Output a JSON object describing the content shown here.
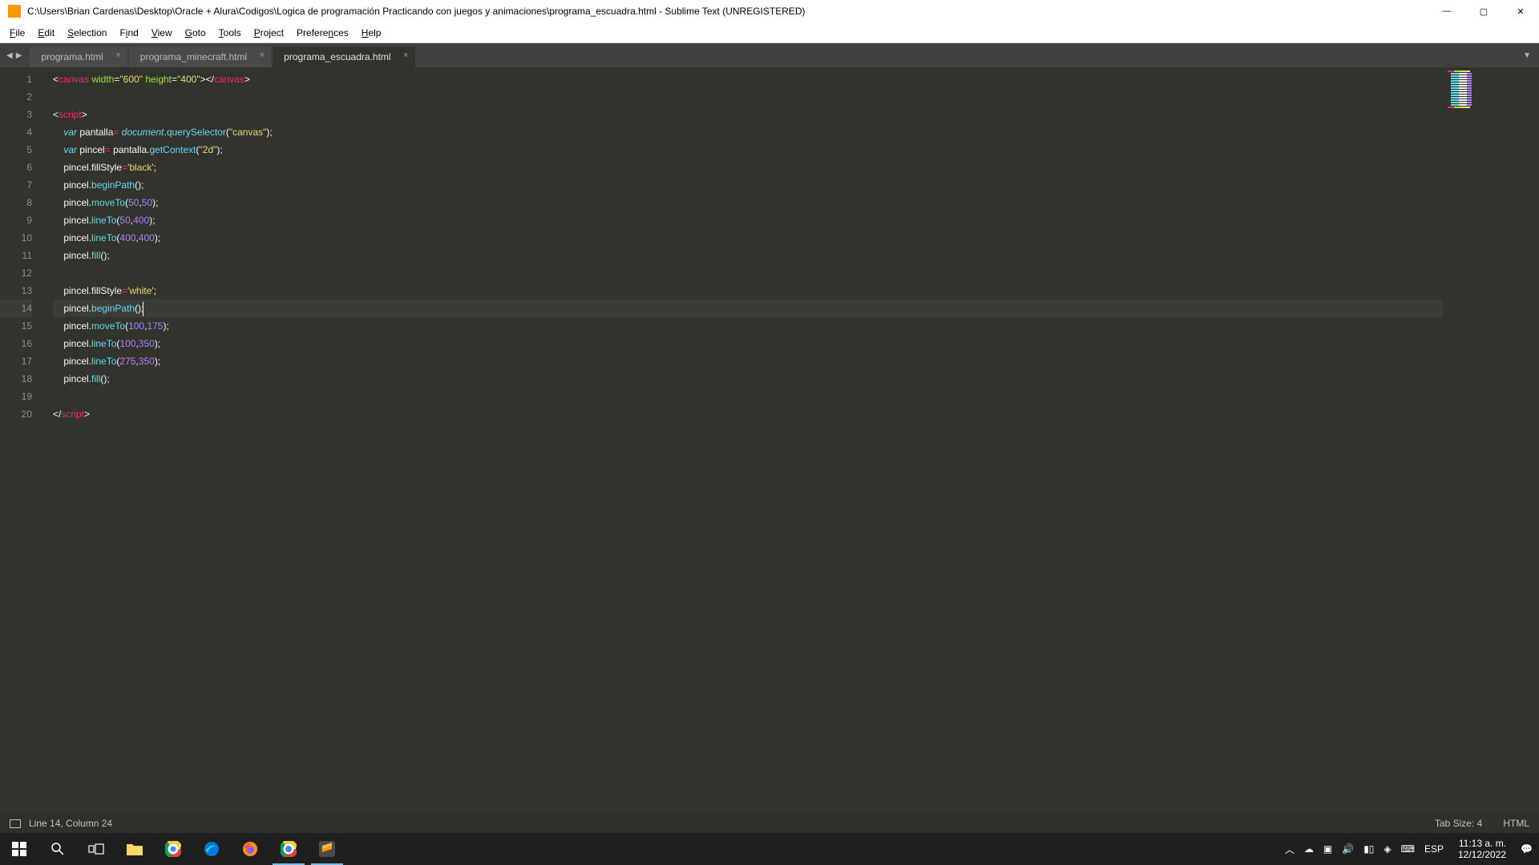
{
  "title": "C:\\Users\\Brian Cardenas\\Desktop\\Oracle + Alura\\Codigos\\Logica de programación Practicando con juegos y animaciones\\programa_escuadra.html - Sublime Text (UNREGISTERED)",
  "menu": {
    "file": "File",
    "edit": "Edit",
    "selection": "Selection",
    "find": "Find",
    "view": "View",
    "goto": "Goto",
    "tools": "Tools",
    "project": "Project",
    "preferences": "Preferences",
    "help": "Help"
  },
  "tabs": [
    {
      "label": "programa.html",
      "active": false
    },
    {
      "label": "programa_minecraft.html",
      "active": false
    },
    {
      "label": "programa_escuadra.html",
      "active": true
    }
  ],
  "code": {
    "lines": [
      {
        "n": 1,
        "html": "<span class='tok-punc'>&lt;</span><span class='tok-tag'>canvas</span> <span class='tok-attr'>width</span><span class='tok-punc'>=</span><span class='tok-str'>\"600\"</span> <span class='tok-attr'>height</span><span class='tok-punc'>=</span><span class='tok-str'>\"400\"</span><span class='tok-punc'>&gt;&lt;/</span><span class='tok-tag'>canvas</span><span class='tok-punc'>&gt;</span>"
      },
      {
        "n": 2,
        "html": ""
      },
      {
        "n": 3,
        "html": "<span class='tok-punc'>&lt;</span><span class='tok-tag'>script</span><span class='tok-punc'>&gt;</span>"
      },
      {
        "n": 4,
        "html": "    <span class='tok-kw'>var</span> <span class='tok-var'>pantalla</span><span class='tok-kw2'>=</span> <span class='tok-obj'>document</span><span class='tok-punc'>.</span><span class='tok-func'>querySelector</span><span class='tok-punc'>(</span><span class='tok-str'>\"canvas\"</span><span class='tok-punc'>);</span>"
      },
      {
        "n": 5,
        "html": "    <span class='tok-kw'>var</span> <span class='tok-var'>pincel</span><span class='tok-kw2'>=</span> <span class='tok-var'>pantalla</span><span class='tok-punc'>.</span><span class='tok-func'>getContext</span><span class='tok-punc'>(</span><span class='tok-str'>\"2d\"</span><span class='tok-punc'>);</span>"
      },
      {
        "n": 6,
        "html": "    <span class='tok-var'>pincel</span><span class='tok-punc'>.</span><span class='tok-var'>fillStyle</span><span class='tok-kw2'>=</span><span class='tok-str'>'black'</span><span class='tok-punc'>;</span>"
      },
      {
        "n": 7,
        "html": "    <span class='tok-var'>pincel</span><span class='tok-punc'>.</span><span class='tok-func'>beginPath</span><span class='tok-punc'>();</span>"
      },
      {
        "n": 8,
        "html": "    <span class='tok-var'>pincel</span><span class='tok-punc'>.</span><span class='tok-func'>moveTo</span><span class='tok-punc'>(</span><span class='tok-num'>50</span><span class='tok-punc'>,</span><span class='tok-num'>50</span><span class='tok-punc'>);</span>"
      },
      {
        "n": 9,
        "html": "    <span class='tok-var'>pincel</span><span class='tok-punc'>.</span><span class='tok-func'>lineTo</span><span class='tok-punc'>(</span><span class='tok-num'>50</span><span class='tok-punc'>,</span><span class='tok-num'>400</span><span class='tok-punc'>);</span>"
      },
      {
        "n": 10,
        "html": "    <span class='tok-var'>pincel</span><span class='tok-punc'>.</span><span class='tok-func'>lineTo</span><span class='tok-punc'>(</span><span class='tok-num'>400</span><span class='tok-punc'>,</span><span class='tok-num'>400</span><span class='tok-punc'>);</span>"
      },
      {
        "n": 11,
        "html": "    <span class='tok-var'>pincel</span><span class='tok-punc'>.</span><span class='tok-func'>fill</span><span class='tok-punc'>();</span>"
      },
      {
        "n": 12,
        "html": ""
      },
      {
        "n": 13,
        "html": "    <span class='tok-var'>pincel</span><span class='tok-punc'>.</span><span class='tok-var'>fillStyle</span><span class='tok-kw2'>=</span><span class='tok-str'>'white'</span><span class='tok-punc'>;</span>"
      },
      {
        "n": 14,
        "html": "    <span class='tok-var'>pincel</span><span class='tok-punc'>.</span><span class='tok-func'>beginPath</span><span class='tok-punc'>();</span><span class='cursor'></span>",
        "hl": true
      },
      {
        "n": 15,
        "html": "    <span class='tok-var'>pincel</span><span class='tok-punc'>.</span><span class='tok-func'>moveTo</span><span class='tok-punc'>(</span><span class='tok-num'>100</span><span class='tok-punc'>,</span><span class='tok-num'>175</span><span class='tok-punc'>);</span>"
      },
      {
        "n": 16,
        "html": "    <span class='tok-var'>pincel</span><span class='tok-punc'>.</span><span class='tok-func'>lineTo</span><span class='tok-punc'>(</span><span class='tok-num'>100</span><span class='tok-punc'>,</span><span class='tok-num'>350</span><span class='tok-punc'>);</span>"
      },
      {
        "n": 17,
        "html": "    <span class='tok-var'>pincel</span><span class='tok-punc'>.</span><span class='tok-func'>lineTo</span><span class='tok-punc'>(</span><span class='tok-num'>275</span><span class='tok-punc'>,</span><span class='tok-num'>350</span><span class='tok-punc'>);</span>"
      },
      {
        "n": 18,
        "html": "    <span class='tok-var'>pincel</span><span class='tok-punc'>.</span><span class='tok-func'>fill</span><span class='tok-punc'>();</span>"
      },
      {
        "n": 19,
        "html": ""
      },
      {
        "n": 20,
        "html": "<span class='tok-punc'>&lt;/</span><span class='tok-tag'>script</span><span class='tok-punc'>&gt;</span>"
      }
    ]
  },
  "statusbar": {
    "position": "Line 14, Column 24",
    "tabsize": "Tab Size: 4",
    "lang": "HTML"
  },
  "tray": {
    "lang": "ESP",
    "time": "11:13 a. m.",
    "date": "12/12/2022"
  }
}
